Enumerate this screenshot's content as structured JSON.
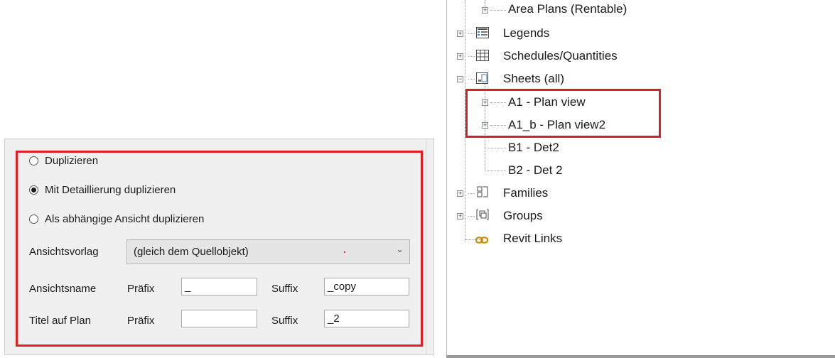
{
  "dialog": {
    "radios": [
      {
        "label": "Duplizieren",
        "selected": false
      },
      {
        "label": "Mit Detaillierung duplizieren",
        "selected": true
      },
      {
        "label": "Als abhängige Ansicht duplizieren",
        "selected": false
      }
    ],
    "view_template": {
      "label": "Ansichtsvorlag",
      "value": "(gleich dem Quellobjekt)"
    },
    "view_name": {
      "label": "Ansichtsname",
      "prefix_label": "Präfix",
      "prefix_value": "_",
      "suffix_label": "Suffix",
      "suffix_value": "_copy"
    },
    "sheet_title": {
      "label": "Titel auf Plan",
      "prefix_label": "Präfix",
      "prefix_value": "",
      "suffix_label": "Suffix",
      "suffix_value": "_2"
    }
  },
  "tree": {
    "nodes": {
      "area_plans": "Area Plans (Rentable)",
      "legends": "Legends",
      "schedules": "Schedules/Quantities",
      "sheets": "Sheets (all)",
      "a1": "A1 - Plan view",
      "a1b": "A1_b - Plan view2",
      "b1": "B1 - Det2",
      "b2": "B2 - Det 2",
      "families": "Families",
      "groups": "Groups",
      "revit_links": "Revit Links"
    },
    "icons": {
      "legends": "legend-icon",
      "schedules": "schedule-icon",
      "sheets": "sheet-icon",
      "families": "family-icon",
      "groups": "group-icon",
      "revit_links": "link-icon"
    },
    "highlight_color": "#d6202c"
  }
}
